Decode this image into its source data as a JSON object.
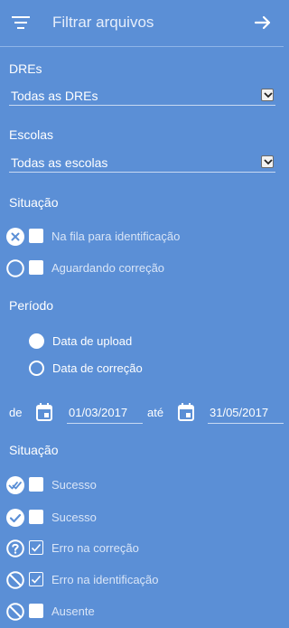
{
  "header": {
    "title": "Filtrar arquivos"
  },
  "dres": {
    "label": "DREs",
    "selected": "Todas as DREs"
  },
  "escolas": {
    "label": "Escolas",
    "selected": "Todas as escolas"
  },
  "situacao1": {
    "label": "Situação",
    "items": [
      {
        "label": "Na fila para identificação",
        "icon": "x-circle-icon",
        "checked": false
      },
      {
        "label": "Aguardando correção",
        "icon": "empty-circle-icon",
        "checked": false
      }
    ]
  },
  "periodo": {
    "label": "Período",
    "options": [
      {
        "label": "Data de upload",
        "selected": true
      },
      {
        "label": "Data de correção",
        "selected": false
      }
    ]
  },
  "dates": {
    "from_label": "de",
    "from": "01/03/2017",
    "to_label": "até",
    "to": "31/05/2017"
  },
  "situacao2": {
    "label": "Situação",
    "items": [
      {
        "label": "Sucesso",
        "icon": "double-check-circle-icon",
        "checked": false
      },
      {
        "label": "Sucesso",
        "icon": "check-circle-icon",
        "checked": false
      },
      {
        "label": "Erro na correção",
        "icon": "question-circle-icon",
        "checked": true
      },
      {
        "label": "Erro na identificação",
        "icon": "blocked-circle-icon",
        "checked": true
      },
      {
        "label": "Ausente",
        "icon": "blocked-circle-icon",
        "checked": false
      }
    ]
  }
}
